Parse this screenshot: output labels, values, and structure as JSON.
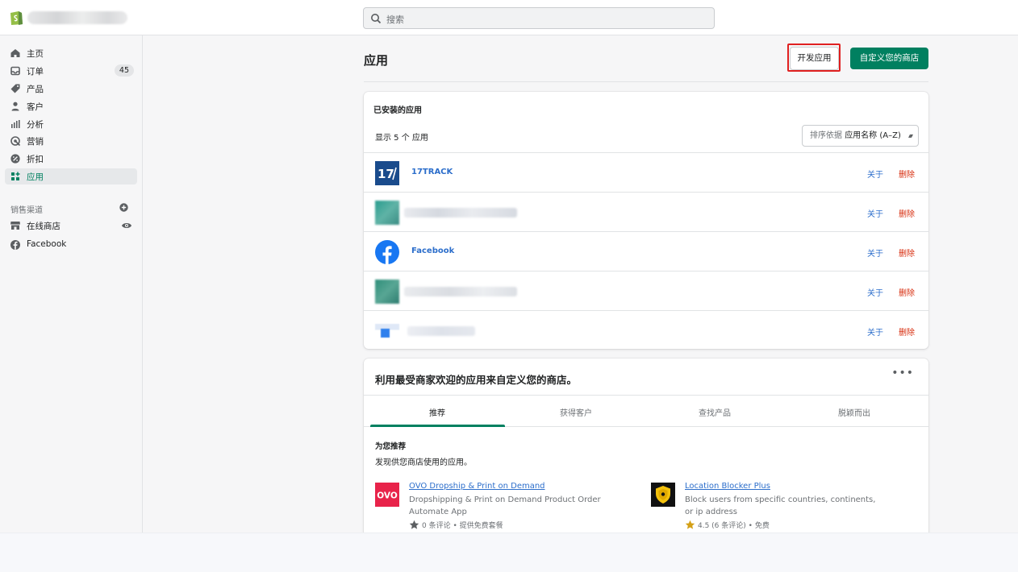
{
  "topbar": {
    "search_placeholder": "搜索"
  },
  "sidebar": {
    "items": [
      {
        "label": "主页",
        "icon": "home-icon"
      },
      {
        "label": "订单",
        "icon": "orders-icon",
        "badge": "45"
      },
      {
        "label": "产品",
        "icon": "tag-icon"
      },
      {
        "label": "客户",
        "icon": "person-icon"
      },
      {
        "label": "分析",
        "icon": "bar-chart-icon"
      },
      {
        "label": "营销",
        "icon": "target-icon"
      },
      {
        "label": "折扣",
        "icon": "discount-icon"
      },
      {
        "label": "应用",
        "icon": "apps-icon",
        "active": true
      }
    ],
    "channels_title": "销售渠道",
    "channels": [
      {
        "label": "在线商店",
        "icon": "store-icon"
      },
      {
        "label": "Facebook",
        "icon": "facebook-icon"
      }
    ]
  },
  "page": {
    "title": "应用",
    "dev_button": "开发应用",
    "customize_button": "自定义您的商店"
  },
  "installed": {
    "title": "已安装的应用",
    "showing": "显示 5 个 应用",
    "sort_prefix": "排序依据",
    "sort_value": "应用名称 (A–Z)",
    "about_label": "关于",
    "delete_label": "删除",
    "apps": [
      {
        "name": "17TRACK",
        "logo_text": "17"
      },
      {
        "name": ""
      },
      {
        "name": "Facebook"
      },
      {
        "name": ""
      },
      {
        "name": ""
      }
    ]
  },
  "recommend": {
    "title": "利用最受商家欢迎的应用来自定义您的商店。",
    "more": "•••",
    "tabs": [
      "推荐",
      "获得客户",
      "查找产品",
      "脱颖而出"
    ],
    "section_title": "为您推荐",
    "section_sub": "发现供您商店使用的应用。",
    "apps": [
      {
        "logo_text": "OVO",
        "name": "OVO Dropship & Print on Demand",
        "desc": "Dropshipping & Print on Demand Product Order Automate App",
        "meta": "0 条评论 • 提供免费套餐"
      },
      {
        "name": "Location Blocker Plus",
        "desc": "Block users from specific countries, continents, or ip address",
        "meta": "4.5 (6 条评论) • 免费"
      }
    ]
  },
  "colors": {
    "accent": "#008060",
    "link": "#2c6ecb",
    "danger": "#d72c0d",
    "highlight_box": "#e02020"
  }
}
